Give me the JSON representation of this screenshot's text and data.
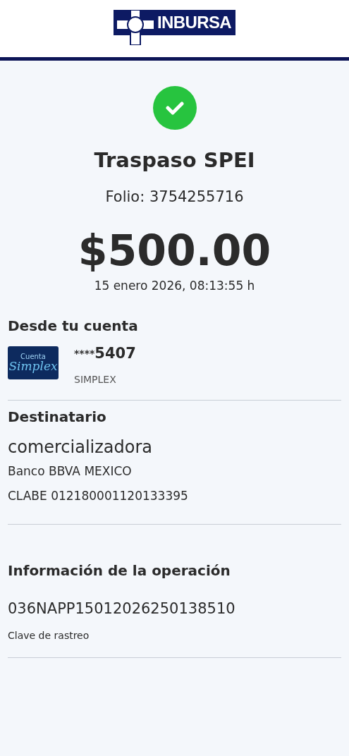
{
  "header": {
    "logo_text": "INBURSA"
  },
  "status": {
    "kind": "success"
  },
  "title": "Traspaso SPEI",
  "folio": "Folio: 3754255716",
  "amount": "$500.00",
  "datetime": "15 enero 2026, 08:13:55 h",
  "from": {
    "heading": "Desde tu cuenta",
    "card_line1": "Cuenta",
    "card_line2": "Simplex",
    "masked": "****",
    "last_digits": "5407",
    "account_type": "SIMPLEX"
  },
  "recipient": {
    "heading": "Destinatario",
    "name": "comercializadora",
    "bank": "Banco BBVA MEXICO",
    "clabe": "CLABE 012180001120133395"
  },
  "operation": {
    "heading": "Información de la operación",
    "tracking_key": "036NAPP15012026250138510",
    "tracking_label": "Clave de rastreo"
  }
}
